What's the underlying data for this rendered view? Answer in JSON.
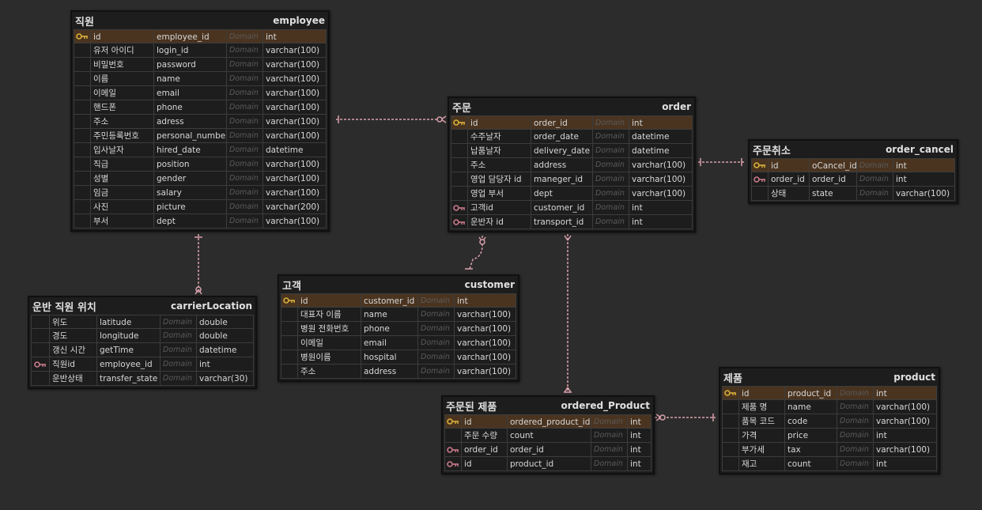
{
  "colors": {
    "background": "#2c2c2c",
    "entity_body": "#1d1d1d",
    "pk_row": "#4a3420",
    "pk_key": "#d8b03a",
    "fk_key": "#c97a8a",
    "relation_line": "#d9a0ac",
    "domain_text": "#5a5a5a"
  },
  "entities": [
    {
      "id": "employee",
      "korean": "직원",
      "english": "employee",
      "rows": [
        {
          "key": "pk",
          "label": "id",
          "column": "employee_id",
          "domain": "Domain",
          "type": "int"
        },
        {
          "key": "",
          "label": "유저 아이디",
          "column": "login_id",
          "domain": "Domain",
          "type": "varchar(100)"
        },
        {
          "key": "",
          "label": "비밀번호",
          "column": "password",
          "domain": "Domain",
          "type": "varchar(100)"
        },
        {
          "key": "",
          "label": "이름",
          "column": "name",
          "domain": "Domain",
          "type": "varchar(100)"
        },
        {
          "key": "",
          "label": "이메일",
          "column": "email",
          "domain": "Domain",
          "type": "varchar(100)"
        },
        {
          "key": "",
          "label": "핸드폰",
          "column": "phone",
          "domain": "Domain",
          "type": "varchar(100)"
        },
        {
          "key": "",
          "label": "주소",
          "column": "adress",
          "domain": "Domain",
          "type": "varchar(100)"
        },
        {
          "key": "",
          "label": "주민등록번호",
          "column": "personal_number",
          "domain": "Domain",
          "type": "varchar(100)"
        },
        {
          "key": "",
          "label": "입사날자",
          "column": "hired_date",
          "domain": "Domain",
          "type": "datetime"
        },
        {
          "key": "",
          "label": "직급",
          "column": "position",
          "domain": "Domain",
          "type": "varchar(100)"
        },
        {
          "key": "",
          "label": "성별",
          "column": "gender",
          "domain": "Domain",
          "type": "varchar(100)"
        },
        {
          "key": "",
          "label": "임금",
          "column": "salary",
          "domain": "Domain",
          "type": "varchar(100)"
        },
        {
          "key": "",
          "label": "사진",
          "column": "picture",
          "domain": "Domain",
          "type": "varchar(200)"
        },
        {
          "key": "",
          "label": "부서",
          "column": "dept",
          "domain": "Domain",
          "type": "varchar(100)"
        }
      ]
    },
    {
      "id": "carrierLocation",
      "korean": "운반 직원 위치",
      "english": "carrierLocation",
      "rows": [
        {
          "key": "",
          "label": "위도",
          "column": "latitude",
          "domain": "Domain",
          "type": "double"
        },
        {
          "key": "",
          "label": "경도",
          "column": "longitude",
          "domain": "Domain",
          "type": "double"
        },
        {
          "key": "",
          "label": "갱신 시간",
          "column": "getTime",
          "domain": "Domain",
          "type": "datetime"
        },
        {
          "key": "fk",
          "label": "직원id",
          "column": "employee_id",
          "domain": "Domain",
          "type": "int"
        },
        {
          "key": "",
          "label": "운반상태",
          "column": "transfer_state",
          "domain": "Domain",
          "type": "varchar(30)"
        }
      ]
    },
    {
      "id": "order",
      "korean": "주문",
      "english": "order",
      "rows": [
        {
          "key": "pk",
          "label": "id",
          "column": "order_id",
          "domain": "Domain",
          "type": "int"
        },
        {
          "key": "",
          "label": "수주날자",
          "column": "order_date",
          "domain": "Domain",
          "type": "datetime"
        },
        {
          "key": "",
          "label": "납품날자",
          "column": "delivery_date",
          "domain": "Domain",
          "type": "datetime"
        },
        {
          "key": "",
          "label": "주소",
          "column": "address",
          "domain": "Domain",
          "type": "varchar(100)"
        },
        {
          "key": "",
          "label": "영업 담당자 id",
          "column": "maneger_id",
          "domain": "Domain",
          "type": "varchar(100)"
        },
        {
          "key": "",
          "label": "영업 부서",
          "column": "dept",
          "domain": "Domain",
          "type": "varchar(100)"
        },
        {
          "key": "fk",
          "label": "고객id",
          "column": "customer_id",
          "domain": "Domain",
          "type": "int"
        },
        {
          "key": "fk",
          "label": "운반자 id",
          "column": "transport_id",
          "domain": "Domain",
          "type": "int"
        }
      ]
    },
    {
      "id": "order_cancel",
      "korean": "주문취소",
      "english": "order_cancel",
      "rows": [
        {
          "key": "pk",
          "label": "id",
          "column": "oCancel_id",
          "domain": "Domain",
          "type": "int"
        },
        {
          "key": "fk",
          "label": "order_id",
          "column": "order_id",
          "domain": "Domain",
          "type": "int"
        },
        {
          "key": "",
          "label": "상태",
          "column": "state",
          "domain": "Domain",
          "type": "varchar(100)"
        }
      ]
    },
    {
      "id": "customer",
      "korean": "고객",
      "english": "customer",
      "rows": [
        {
          "key": "pk",
          "label": "id",
          "column": "customer_id",
          "domain": "Domain",
          "type": "int"
        },
        {
          "key": "",
          "label": "대표자 이름",
          "column": "name",
          "domain": "Domain",
          "type": "varchar(100)"
        },
        {
          "key": "",
          "label": "병원 전화번호",
          "column": "phone",
          "domain": "Domain",
          "type": "varchar(100)"
        },
        {
          "key": "",
          "label": "이메일",
          "column": "email",
          "domain": "Domain",
          "type": "varchar(100)"
        },
        {
          "key": "",
          "label": "병원이름",
          "column": "hospital",
          "domain": "Domain",
          "type": "varchar(100)"
        },
        {
          "key": "",
          "label": "주소",
          "column": "address",
          "domain": "Domain",
          "type": "varchar(100)"
        }
      ]
    },
    {
      "id": "ordered_Product",
      "korean": "주문된 제품",
      "english": "ordered_Product",
      "rows": [
        {
          "key": "pk",
          "label": "id",
          "column": "ordered_product_id",
          "domain": "Domain",
          "type": "int"
        },
        {
          "key": "",
          "label": "주문 수량",
          "column": "count",
          "domain": "Domain",
          "type": "int"
        },
        {
          "key": "fk",
          "label": "order_id",
          "column": "order_id",
          "domain": "Domain",
          "type": "int"
        },
        {
          "key": "fk",
          "label": "id",
          "column": "product_id",
          "domain": "Domain",
          "type": "int"
        }
      ]
    },
    {
      "id": "product",
      "korean": "제품",
      "english": "product",
      "rows": [
        {
          "key": "pk",
          "label": "id",
          "column": "product_id",
          "domain": "Domain",
          "type": "int"
        },
        {
          "key": "",
          "label": "제품 명",
          "column": "name",
          "domain": "Domain",
          "type": "varchar(100)"
        },
        {
          "key": "",
          "label": "품목 코드",
          "column": "code",
          "domain": "Domain",
          "type": "varchar(100)"
        },
        {
          "key": "",
          "label": "가격",
          "column": "price",
          "domain": "Domain",
          "type": "int"
        },
        {
          "key": "",
          "label": "부가세",
          "column": "tax",
          "domain": "Domain",
          "type": "varchar(100)"
        },
        {
          "key": "",
          "label": "재고",
          "column": "count",
          "domain": "Domain",
          "type": "int"
        }
      ]
    }
  ]
}
